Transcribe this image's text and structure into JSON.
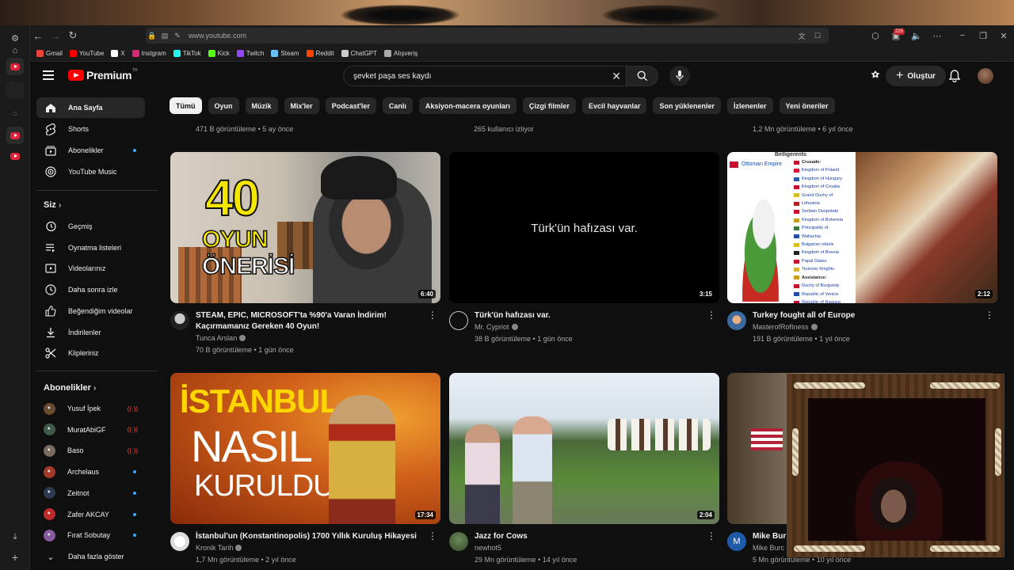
{
  "browser": {
    "url": "www.youtube.com",
    "notif_count": "225",
    "bookmarks": [
      {
        "label": "Gmail",
        "color": "#ea4335"
      },
      {
        "label": "YouTube",
        "color": "#ff0000"
      },
      {
        "label": "X",
        "color": "#ffffff"
      },
      {
        "label": "Instgram",
        "color": "#d62976"
      },
      {
        "label": "TikTok",
        "color": "#25f4ee"
      },
      {
        "label": "Kick",
        "color": "#53fc18"
      },
      {
        "label": "Twitch",
        "color": "#9146ff"
      },
      {
        "label": "Steam",
        "color": "#66c0f4"
      },
      {
        "label": "Reddit",
        "color": "#ff4500"
      },
      {
        "label": "ChatGPT",
        "color": "#cccccc"
      },
      {
        "label": "Alışveriş",
        "color": "#aaaaaa"
      }
    ]
  },
  "youtube": {
    "logo": "Premium",
    "logo_sup": "TR",
    "search_query": "şevket paşa ses kaydı",
    "create_label": "Oluştur"
  },
  "sidebar": {
    "main": [
      {
        "label": "Ana Sayfa",
        "icon": "home-icon",
        "active": true
      },
      {
        "label": "Shorts",
        "icon": "shorts-icon"
      },
      {
        "label": "Abonelikler",
        "icon": "subscriptions-icon",
        "dot": true
      },
      {
        "label": "YouTube Music",
        "icon": "music-icon"
      }
    ],
    "you_header": "Siz",
    "you": [
      {
        "label": "Geçmiş",
        "icon": "history-icon"
      },
      {
        "label": "Oynatma listeleri",
        "icon": "playlist-icon"
      },
      {
        "label": "Videolarınız",
        "icon": "your-videos-icon"
      },
      {
        "label": "Daha sonra izle",
        "icon": "watch-later-icon"
      },
      {
        "label": "Beğendiğim videolar",
        "icon": "like-icon"
      },
      {
        "label": "İndirilenler",
        "icon": "download-icon"
      },
      {
        "label": "Klipleriniz",
        "icon": "clips-icon"
      }
    ],
    "subs_header": "Abonelikler",
    "subs": [
      {
        "label": "Yusuf İpek",
        "status": "live",
        "color": "#6b4a32"
      },
      {
        "label": "MuratAbiGF",
        "status": "live",
        "color": "#3f5a4a"
      },
      {
        "label": "Baso",
        "status": "live",
        "color": "#7a6a60"
      },
      {
        "label": "Archelaus",
        "status": "dot",
        "color": "#a33a2a"
      },
      {
        "label": "Zeitnot",
        "status": "dot",
        "color": "#2a3a50"
      },
      {
        "label": "Zafer AKCAY",
        "status": "dot",
        "color": "#c02a2a"
      },
      {
        "label": "Fırat Sobutay",
        "status": "dot",
        "color": "#8a5aa0"
      }
    ],
    "show_more": "Daha fazla göster"
  },
  "chips": [
    "Tümü",
    "Oyun",
    "Müzik",
    "Mix'ler",
    "Podcast'ler",
    "Canlı",
    "Aksiyon-macera oyunları",
    "Çizgi filmler",
    "Evcil hayvanlar",
    "Son yüklenenler",
    "İzlenenler",
    "Yeni öneriler"
  ],
  "top_row_meta": [
    "471 B görüntüleme • 5 ay önce",
    "265 kullanıcı izliyor",
    "1,2 Mn görüntüleme • 6 yıl önce"
  ],
  "videos": [
    {
      "title": "STEAM, EPIC, MICROSOFT'ta %90'a Varan İndirim! Kaçırmamanız Gereken 40 Oyun!",
      "channel": "Tunca Arslan",
      "meta": "70 B görüntüleme • 1 gün önce",
      "duration": "6:40",
      "thumb_text": [
        "40",
        "OYUN",
        "ÖNERİSİ"
      ]
    },
    {
      "title": "Türk'ün hafızası var.",
      "channel": "Mr. Cypriot",
      "meta": "38 B görüntüleme • 1 gün önce",
      "duration": "3:15",
      "thumb_text": "Türk'ün hafızası var."
    },
    {
      "title": "Turkey fought all of Europe",
      "channel": "MasterofRofIness",
      "meta": "191 B görüntüleme • 1 yıl önce",
      "duration": "2:12",
      "thumb_header": "Belligerents",
      "thumb_empire": "Ottoman Empire",
      "thumb_list": [
        "Crusade:",
        "Kingdom of Poland",
        "Kingdom of Hungary",
        "Kingdom of Croatia",
        "Grand Duchy of",
        "Lithuania",
        "Serbian Despotate",
        "Kingdom of Bohemia",
        "Principality of",
        "Wallachia",
        "Bulgarian rebels",
        "Kingdom of Bosnia",
        "Papal States",
        "Teutonic Knights",
        "Assistance:",
        "Duchy of Burgundy",
        "Republic of Venice",
        "Republic of Ragusa"
      ]
    },
    {
      "title": "İstanbul'un (Konstantinopolis) 1700 Yıllık Kuruluş Hikayesi",
      "channel": "Kronik Tarih",
      "meta": "1,7 Mn görüntüleme • 2 yıl önce",
      "duration": "17:34",
      "thumb_text": [
        "İSTANBUL",
        "NASIL",
        "KURULDU?"
      ]
    },
    {
      "title": "Jazz for Cows",
      "channel": "newhot5",
      "meta": "29 Mn görüntüleme • 14 yıl önce",
      "duration": "2:04"
    },
    {
      "title": "Mike Bur",
      "channel": "Mike Burc",
      "meta": "5 Mn görüntüleme • 10 yıl önce",
      "avatar_letter": "M"
    }
  ]
}
